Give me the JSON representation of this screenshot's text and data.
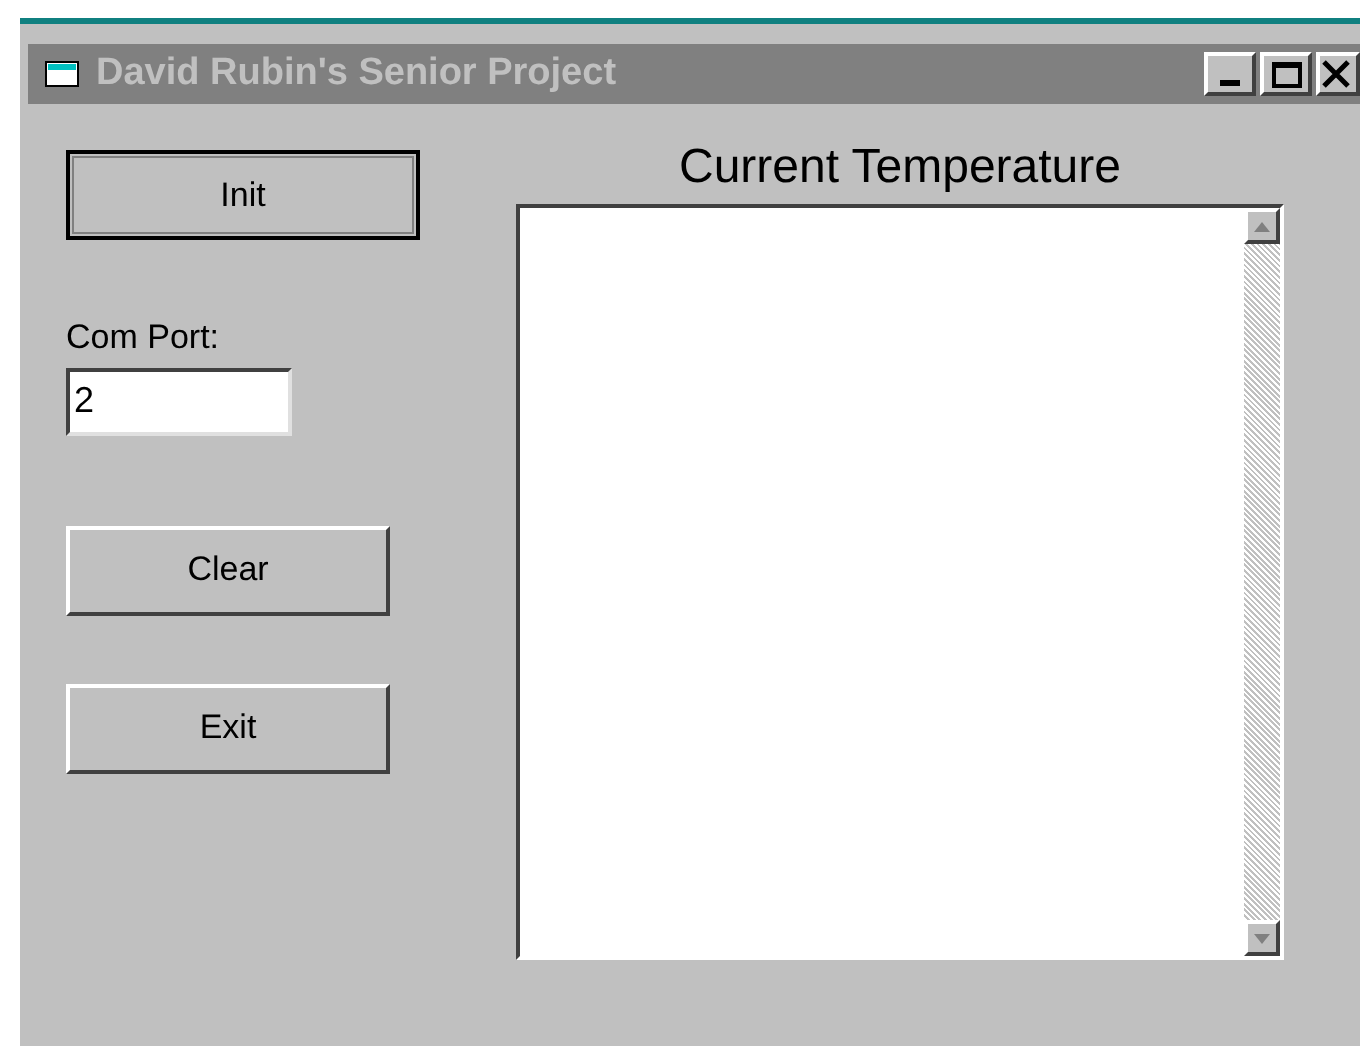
{
  "window": {
    "title": "David Rubin's Senior Project",
    "active": false
  },
  "buttons": [
    {
      "label": "Init",
      "default": true
    },
    {
      "label": "Clear",
      "default": false
    },
    {
      "label": "Exit",
      "default": false
    }
  ],
  "com_port": {
    "label": "Com Port:",
    "value": "2"
  },
  "temperature": {
    "title": "Current Temperature"
  }
}
